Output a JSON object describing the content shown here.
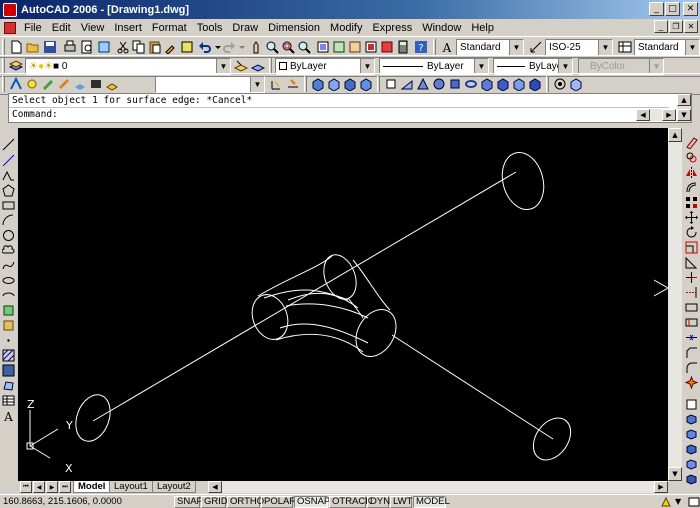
{
  "window": {
    "title": "AutoCAD 2006 - [Drawing1.dwg]"
  },
  "menu": [
    "File",
    "Edit",
    "View",
    "Insert",
    "Format",
    "Tools",
    "Draw",
    "Dimension",
    "Modify",
    "Express",
    "Window",
    "Help"
  ],
  "toolbar": {
    "text_style": "Standard",
    "dim_style": "ISO-25",
    "table_style": "Standard",
    "layer": "0",
    "color": "ByLayer",
    "linetype": "ByLayer",
    "lineweight": "ByLayer",
    "plot_style": "ByColor"
  },
  "command": {
    "line1": "Select object 1 for surface edge: *Cancel*",
    "line2": "Command:"
  },
  "ucs": {
    "x": "X",
    "y": "Y",
    "z": "Z"
  },
  "tabs": [
    {
      "label": "Model",
      "active": true
    },
    {
      "label": "Layout1",
      "active": false
    },
    {
      "label": "Layout2",
      "active": false
    }
  ],
  "status": {
    "coordinates": "160.8663, 215.1606, 0.0000",
    "toggles": [
      {
        "label": "SNAP",
        "on": false
      },
      {
        "label": "GRID",
        "on": false
      },
      {
        "label": "ORTHO",
        "on": false
      },
      {
        "label": "POLAR",
        "on": false
      },
      {
        "label": "OSNAP",
        "on": true
      },
      {
        "label": "OTRACK",
        "on": false
      },
      {
        "label": "DYN",
        "on": false
      },
      {
        "label": "LWT",
        "on": false
      },
      {
        "label": "MODEL",
        "on": true
      }
    ]
  },
  "colors": {
    "canvas": "#000000",
    "drawing_lines": "#ffffff",
    "title_start": "#0a246a",
    "title_end": "#a6caf0",
    "chrome": "#d4d0c8"
  }
}
